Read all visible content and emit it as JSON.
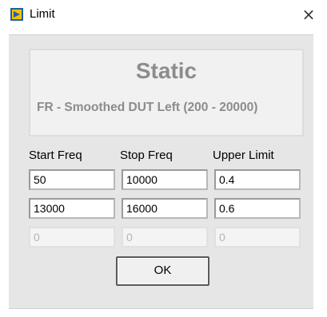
{
  "window": {
    "title": "Limit",
    "close_glyph": "×",
    "icon": "labview-app-icon"
  },
  "info": {
    "heading": "Static",
    "subtitle": "FR - Smoothed DUT Left (200 - 20000)"
  },
  "table": {
    "headers": [
      "Start Freq",
      "Stop Freq",
      "Upper Limit"
    ],
    "rows": [
      [
        "50",
        "10000",
        "0.4"
      ],
      [
        "13000",
        "16000",
        "0.6"
      ],
      [
        "0",
        "0",
        "0"
      ]
    ]
  },
  "ok_label": "OK"
}
